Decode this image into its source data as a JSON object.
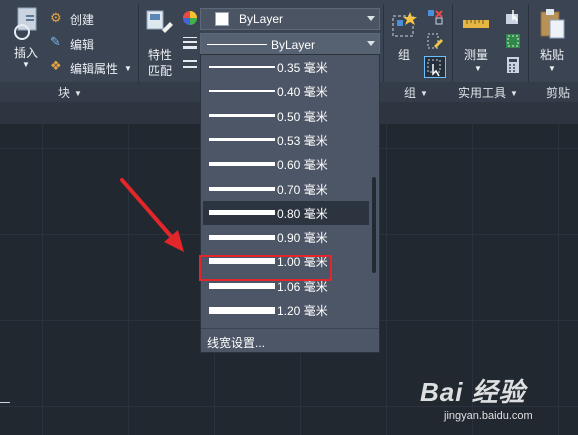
{
  "ribbon": {
    "insert_label": "插入",
    "create_label": "创建",
    "edit_label": "编辑",
    "edit_attr_label": "编辑属性",
    "match_label_1": "特性",
    "match_label_2": "匹配",
    "group_label": "组",
    "measure_label": "测量",
    "paste_label": "粘贴",
    "color_value": "ByLayer",
    "lineweight_value": "ByLayer"
  },
  "panels": {
    "block": "块",
    "group": "组",
    "utilities": "实用工具",
    "clipboard": "剪贴"
  },
  "lineweight_list": {
    "items": [
      {
        "label": "0.35 毫米",
        "weight": 0.35
      },
      {
        "label": "0.40 毫米",
        "weight": 0.4
      },
      {
        "label": "0.50 毫米",
        "weight": 0.5
      },
      {
        "label": "0.53 毫米",
        "weight": 0.53
      },
      {
        "label": "0.60 毫米",
        "weight": 0.6
      },
      {
        "label": "0.70 毫米",
        "weight": 0.7
      },
      {
        "label": "0.80 毫米",
        "weight": 0.8
      },
      {
        "label": "0.90 毫米",
        "weight": 0.9
      },
      {
        "label": "1.00 毫米",
        "weight": 1.0
      },
      {
        "label": "1.06 毫米",
        "weight": 1.06
      },
      {
        "label": "1.20 毫米",
        "weight": 1.2
      }
    ],
    "hovered": "0.80 毫米",
    "highlighted": "1.00 毫米",
    "footer_label": "线宽设置..."
  },
  "watermark": {
    "main": "Bai 经验",
    "sub": "jingyan.baidu.com"
  },
  "colors": {
    "ribbon_bg": "#3b4453",
    "canvas_bg": "#212830",
    "dropdown_bg": "#4d5666",
    "highlight": "#e2262a",
    "arrow": "#e2262a"
  }
}
